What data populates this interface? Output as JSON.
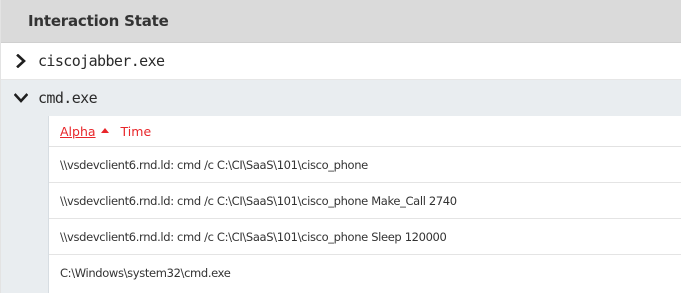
{
  "panel": {
    "title": "Interaction State"
  },
  "groups": [
    {
      "label": "ciscojabber.exe",
      "expanded": false,
      "chevron_icon": "chevron-right-icon"
    },
    {
      "label": "cmd.exe",
      "expanded": true,
      "chevron_icon": "chevron-down-icon"
    }
  ],
  "sort": {
    "alpha_label": "Alpha",
    "time_label": "Time",
    "active": "Alpha",
    "direction_icon": "sort-ascending-icon",
    "color": "#e8262a"
  },
  "items": [
    "\\\\vsdevclient6.rnd.ld: cmd /c C:\\CI\\SaaS\\101\\cisco_phone",
    "\\\\vsdevclient6.rnd.ld: cmd /c C:\\CI\\SaaS\\101\\cisco_phone Make_Call 2740",
    "\\\\vsdevclient6.rnd.ld: cmd /c C:\\CI\\SaaS\\101\\cisco_phone Sleep 120000",
    "C:\\Windows\\system32\\cmd.exe"
  ]
}
